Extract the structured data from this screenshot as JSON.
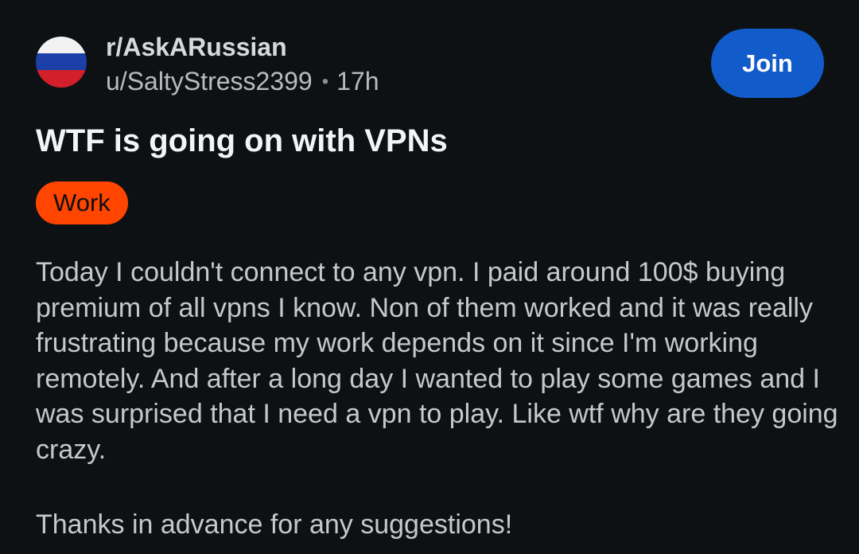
{
  "post": {
    "community": "r/AskARussian",
    "author": "u/SaltyStress2399",
    "separator": "•",
    "age": "17h",
    "join_label": "Join",
    "title": "WTF is going on with VPNs",
    "flair": "Work",
    "paragraphs": [
      "Today I couldn't connect to any vpn. I paid around 100$ buying premium of all vpns I know. Non of them worked and it was really frustrating because my work depends on it since I'm working remotely. And after a long day I wanted to play some games and I was surprised that I need a vpn to play. Like wtf why are they going crazy.",
      "Thanks in advance for any suggestions!"
    ]
  },
  "colors": {
    "background": "#0e1113",
    "join_button": "#115bca",
    "flair_background": "#ff4500",
    "flag_white": "#f2f2f2",
    "flag_blue": "#1c3fa8",
    "flag_red": "#d21f2a"
  },
  "icons": {
    "community_avatar": "russia-flag-icon"
  }
}
